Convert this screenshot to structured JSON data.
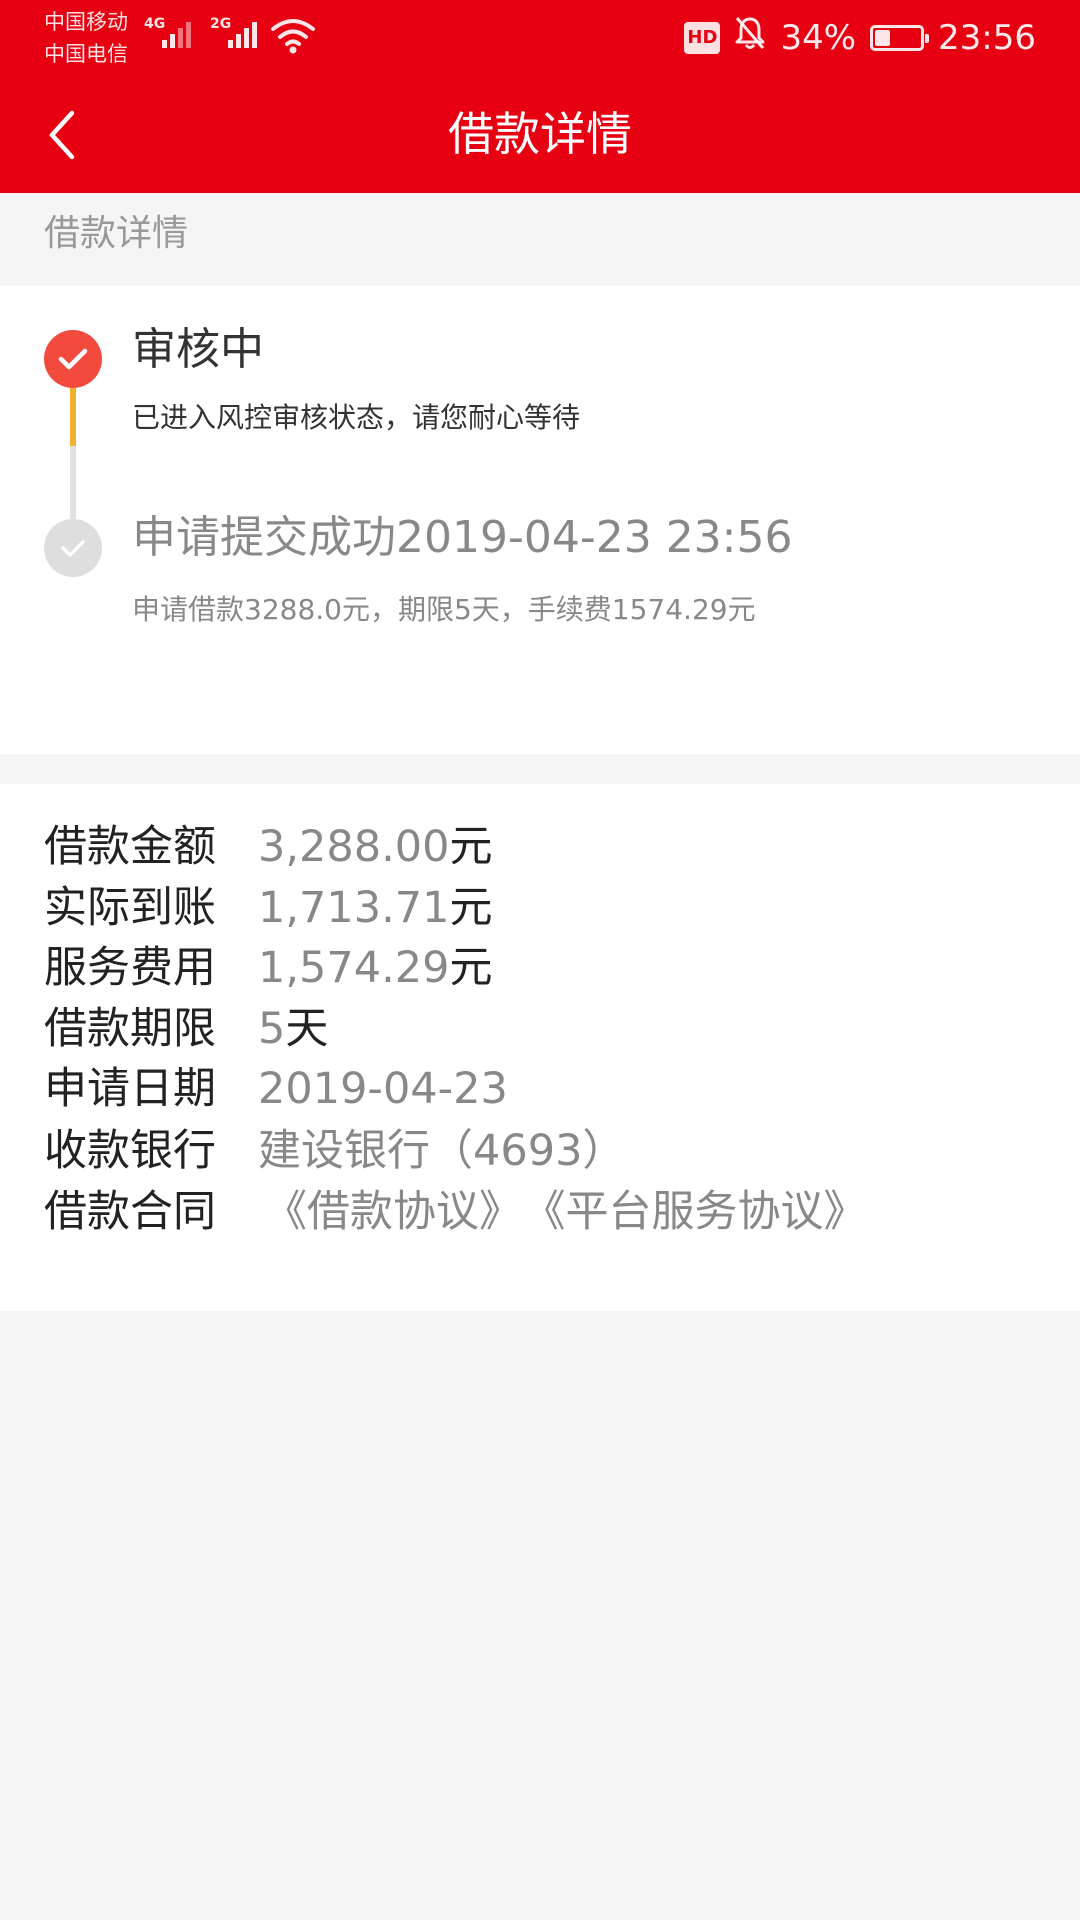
{
  "status_bar": {
    "carrier_1": "中国移动",
    "carrier_2": "中国电信",
    "network_1": "4G",
    "network_2": "2G",
    "hd": "HD",
    "battery": "34%",
    "battery_level": 0.34,
    "time": "23:56",
    "icons": [
      "signal-icon",
      "wifi-icon",
      "mute-bell-icon",
      "battery-icon"
    ]
  },
  "header": {
    "title": "借款详情",
    "back_icon": "chevron-left-icon",
    "background": "#e60012"
  },
  "section_label": "借款详情",
  "timeline": {
    "steps": [
      {
        "title": "审核中",
        "description": "已进入风控审核状态，请您耐心等待",
        "status": "active",
        "dot_color": "#f24b3e"
      },
      {
        "title": "申请提交成功2019-04-23 23:56",
        "description": "申请借款3288.0元，期限5天，手续费1574.29元",
        "status": "done",
        "dot_color": "#dedede"
      }
    ],
    "line_colors": [
      "#f0b12e",
      "#e2e2e2"
    ]
  },
  "details": {
    "amount": {
      "label": "借款金额",
      "value": "3,288.00",
      "unit": "元"
    },
    "received": {
      "label": "实际到账",
      "value": "1,713.71",
      "unit": "元"
    },
    "fee": {
      "label": "服务费用",
      "value": "1,574.29",
      "unit": "元"
    },
    "term": {
      "label": "借款期限",
      "value": "5",
      "unit": "天"
    },
    "date": {
      "label": "申请日期",
      "value": "2019-04-23"
    },
    "bank": {
      "label": "收款银行",
      "value": "建设银行（4693）"
    },
    "contract": {
      "label": "借款合同",
      "links": [
        "《借款协议》",
        "《平台服务协议》"
      ]
    }
  }
}
